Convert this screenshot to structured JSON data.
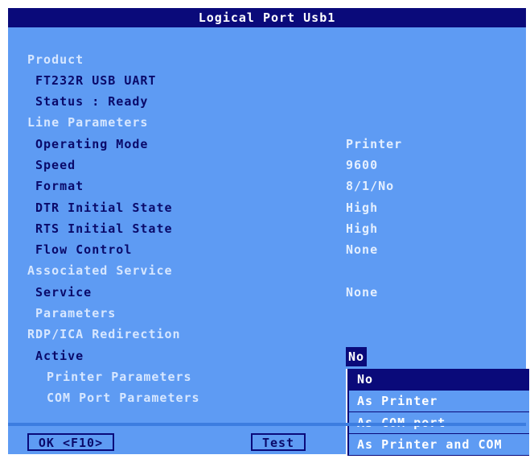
{
  "window": {
    "title": "Logical Port Usb1"
  },
  "product": {
    "section": "Product",
    "name": "FT232R USB UART",
    "status": "Status : Ready"
  },
  "line_parameters": {
    "section": "Line Parameters",
    "rows": [
      {
        "label": "Operating Mode",
        "value": "Printer"
      },
      {
        "label": "Speed",
        "value": "9600"
      },
      {
        "label": "Format",
        "value": "8/1/No"
      },
      {
        "label": "DTR Initial State",
        "value": "High"
      },
      {
        "label": "RTS Initial State",
        "value": "High"
      },
      {
        "label": "Flow Control",
        "value": "None"
      }
    ]
  },
  "associated_service": {
    "section": "Associated Service",
    "service_label": "Service",
    "service_value": "None",
    "parameters_label": "Parameters"
  },
  "rdp": {
    "section": "RDP/ICA Redirection",
    "active_label": "Active",
    "active_value": "No",
    "printer_params": "Printer Parameters",
    "com_params": "COM Port Parameters"
  },
  "dropdown": {
    "options": [
      "No",
      "As Printer",
      "As COM port",
      "As Printer and COM"
    ],
    "selected": "No"
  },
  "buttons": {
    "ok": "OK <F10>",
    "test": "Test"
  },
  "colors": {
    "background": "#5e9bf3",
    "titlebar": "#0a0a7a",
    "highlight": "#0a0a7a"
  }
}
